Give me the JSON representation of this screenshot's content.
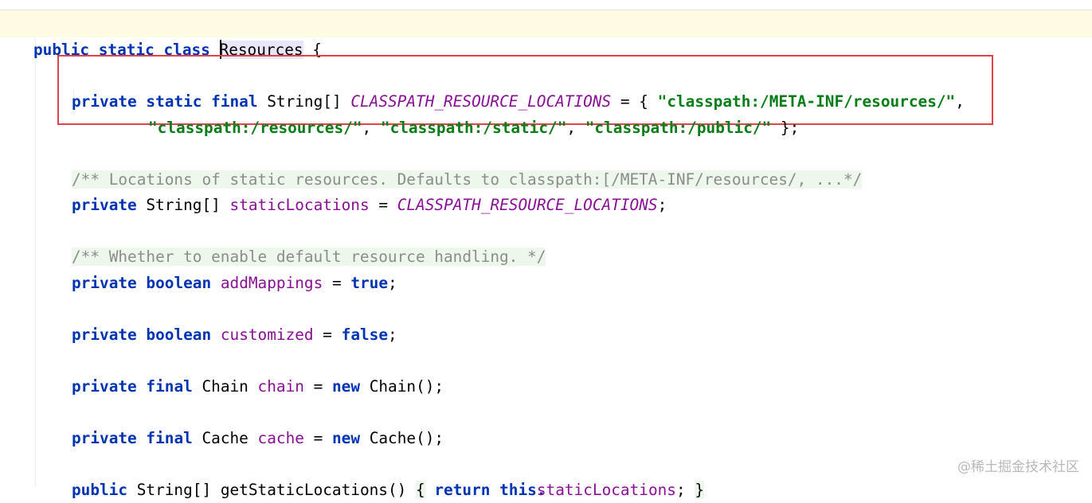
{
  "editor": {
    "lines": [
      {
        "id": "class-decl",
        "tokens": [
          "public",
          "static",
          "class",
          "Resources",
          "{"
        ]
      },
      {
        "id": "locations-1",
        "tokens": [
          "private",
          "static",
          "final",
          "String[]",
          "CLASSPATH_RESOURCE_LOCATIONS",
          "=",
          "{",
          "\"classpath:/META-INF/resources/\"",
          ","
        ]
      },
      {
        "id": "locations-2",
        "tokens": [
          "\"classpath:/resources/\"",
          ",",
          "\"classpath:/static/\"",
          ",",
          "\"classpath:/public/\"",
          "};"
        ]
      },
      {
        "id": "doc-1",
        "text": "/** Locations of static resources. Defaults to classpath:[/META-INF/resources/, ...*/"
      },
      {
        "id": "static-locations",
        "tokens": [
          "private",
          "String[]",
          "staticLocations",
          "=",
          "CLASSPATH_RESOURCE_LOCATIONS",
          ";"
        ]
      },
      {
        "id": "doc-2",
        "text": "/** Whether to enable default resource handling. */"
      },
      {
        "id": "add-mappings",
        "tokens": [
          "private",
          "boolean",
          "addMappings",
          "=",
          "true",
          ";"
        ]
      },
      {
        "id": "customized",
        "tokens": [
          "private",
          "boolean",
          "customized",
          "=",
          "false",
          ";"
        ]
      },
      {
        "id": "chain",
        "tokens": [
          "private",
          "final",
          "Chain",
          "chain",
          "=",
          "new",
          "Chain();"
        ]
      },
      {
        "id": "cache",
        "tokens": [
          "private",
          "final",
          "Cache",
          "cache",
          "=",
          "new",
          "Cache();"
        ]
      },
      {
        "id": "getter",
        "tokens": [
          "public",
          "String[]",
          "getStaticLocations()",
          "{",
          "return",
          "this.",
          "staticLocations",
          ";",
          "}"
        ]
      }
    ]
  },
  "watermark": "@稀土掘金技术社区",
  "colors": {
    "keyword": "#0033b3",
    "string": "#067d17",
    "field": "#871094",
    "comment": "#8c8c8c",
    "highlight_box": "#e0424a",
    "caret_line": "#fffae3"
  }
}
